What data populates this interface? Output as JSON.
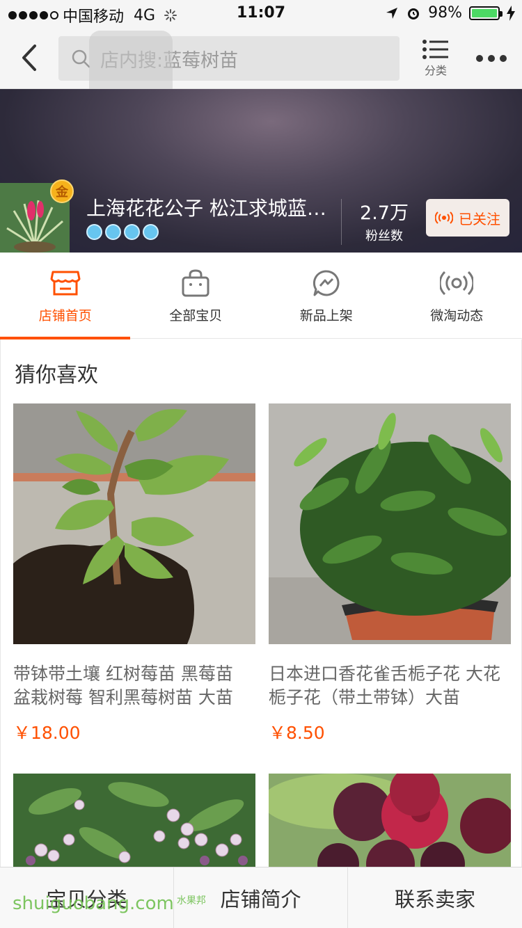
{
  "status_bar": {
    "carrier": "中国移动",
    "network": "4G",
    "time": "11:07",
    "battery": "98%"
  },
  "nav": {
    "search_placeholder": "店内搜:蓝莓树苗",
    "category_label": "分类"
  },
  "shop": {
    "name": "上海花花公子 松江求城蓝莓园艺",
    "badge": "金",
    "fans_count": "2.7万",
    "fans_label": "粉丝数",
    "follow_label": "已关注"
  },
  "tabs": [
    {
      "label": "店铺首页",
      "icon": "store-icon",
      "active": true
    },
    {
      "label": "全部宝贝",
      "icon": "shopping-bag-icon",
      "active": false
    },
    {
      "label": "新品上架",
      "icon": "new-arrival-icon",
      "active": false
    },
    {
      "label": "微淘动态",
      "icon": "broadcast-icon",
      "active": false
    }
  ],
  "section": {
    "title": "猜你喜欢"
  },
  "products": [
    {
      "title": "带钵带土壤 红树莓苗 黑莓苗 盆栽树莓 智利黑莓树苗 大苗",
      "price": "￥18.00"
    },
    {
      "title": "日本进口香花雀舌栀子花 大花栀子花（带土带钵）大苗",
      "price": "￥8.50"
    },
    {
      "title": "",
      "price": ""
    },
    {
      "title": "",
      "price": ""
    }
  ],
  "bottom_bar": {
    "categories": "宝贝分类",
    "shop_intro": "店铺简介",
    "contact": "联系卖家"
  },
  "watermark": {
    "text": "shuiguobang.com",
    "cn": "水果邦"
  },
  "colors": {
    "accent": "#ff5000",
    "battery": "#4cd964"
  }
}
